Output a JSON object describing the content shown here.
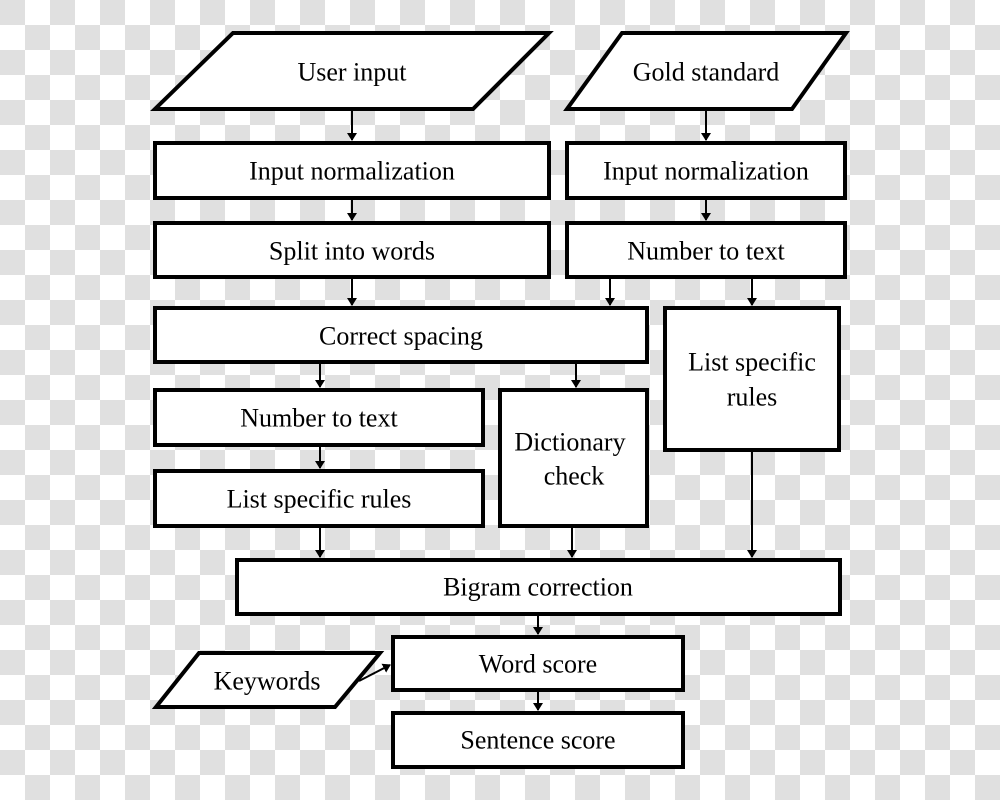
{
  "diagram": {
    "type": "flowchart",
    "colors": {
      "stroke": "#000000",
      "fill": "#ffffff"
    },
    "nodes": {
      "user_input": {
        "label": "User input",
        "shape": "parallelogram"
      },
      "gold_standard": {
        "label": "Gold standard",
        "shape": "parallelogram"
      },
      "input_norm_left": {
        "label": "Input normalization",
        "shape": "rectangle"
      },
      "input_norm_right": {
        "label": "Input normalization",
        "shape": "rectangle"
      },
      "split_words": {
        "label": "Split into words",
        "shape": "rectangle"
      },
      "number_text_right": {
        "label": "Number to text",
        "shape": "rectangle"
      },
      "correct_spacing": {
        "label": "Correct spacing",
        "shape": "rectangle"
      },
      "list_rules_right": {
        "label_line1": "List specific",
        "label_line2": "rules",
        "shape": "rectangle"
      },
      "number_text_left": {
        "label": "Number to text",
        "shape": "rectangle"
      },
      "dictionary_check": {
        "label_line1": "Dictionary",
        "label_line2": "check",
        "shape": "rectangle"
      },
      "list_rules_left": {
        "label": "List specific rules",
        "shape": "rectangle"
      },
      "bigram": {
        "label": "Bigram correction",
        "shape": "rectangle"
      },
      "keywords": {
        "label": "Keywords",
        "shape": "parallelogram"
      },
      "word_score": {
        "label": "Word score",
        "shape": "rectangle"
      },
      "sentence_score": {
        "label": "Sentence score",
        "shape": "rectangle"
      }
    },
    "edges": [
      {
        "from": "User input",
        "to": "Input normalization (left)"
      },
      {
        "from": "Gold standard",
        "to": "Input normalization (right)"
      },
      {
        "from": "Input normalization (left)",
        "to": "Split into words"
      },
      {
        "from": "Input normalization (right)",
        "to": "Number to text (right)"
      },
      {
        "from": "Split into words",
        "to": "Correct spacing"
      },
      {
        "from": "Number to text (right)",
        "to": "Correct spacing"
      },
      {
        "from": "Number to text (right)",
        "to": "List specific rules (right)"
      },
      {
        "from": "Correct spacing",
        "to": "Number to text (left)"
      },
      {
        "from": "Correct spacing",
        "to": "Dictionary check"
      },
      {
        "from": "Number to text (left)",
        "to": "List specific rules (left)"
      },
      {
        "from": "List specific rules (left)",
        "to": "Bigram correction"
      },
      {
        "from": "Dictionary check",
        "to": "Bigram correction"
      },
      {
        "from": "List specific rules (right)",
        "to": "Bigram correction"
      },
      {
        "from": "Bigram correction",
        "to": "Word score"
      },
      {
        "from": "Keywords",
        "to": "Word score"
      },
      {
        "from": "Word score",
        "to": "Sentence score"
      }
    ]
  }
}
